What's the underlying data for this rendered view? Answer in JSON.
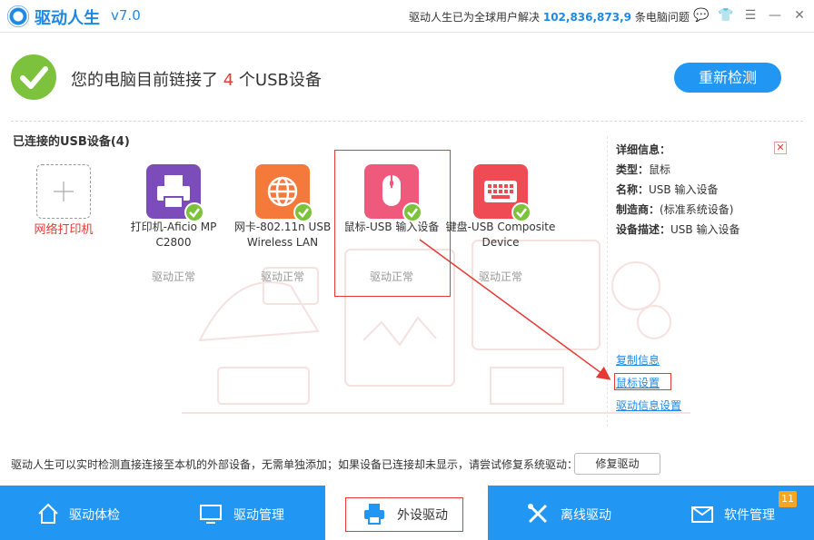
{
  "app": {
    "name": "驱动人生",
    "version": "v7.0",
    "stats_prefix": "驱动人生已为全球用户解决",
    "stats_number": "102,836,873,9",
    "stats_suffix": "条电脑问题"
  },
  "window_controls": {
    "feedback": "💬",
    "skin": "👕",
    "menu": "☰",
    "minimize": "—",
    "close": "✕"
  },
  "header": {
    "text_prefix": "您的电脑目前链接了",
    "count": "4",
    "text_suffix": "个USB设备",
    "recheck_label": "重新检测"
  },
  "section_title": "已连接的USB设备(4)",
  "add_printer_label": "网络打印机",
  "devices": [
    {
      "name": "打印机-Aficio MP C2800",
      "status": "驱动正常",
      "color": "#7c4dba"
    },
    {
      "name": "网卡-802.11n USB Wireless LAN",
      "status": "驱动正常",
      "color": "#f5793a"
    },
    {
      "name": "鼠标-USB 输入设备",
      "status": "驱动正常",
      "color": "#ef5a7c"
    },
    {
      "name": "键盘-USB Composite Device",
      "status": "驱动正常",
      "color": "#ef4b55"
    }
  ],
  "detail": {
    "title": "详细信息：",
    "rows": [
      {
        "key": "类型：",
        "value": "鼠标"
      },
      {
        "key": "名称：",
        "value": "USB 输入设备"
      },
      {
        "key": "制造商：",
        "value": "(标准系统设备)"
      },
      {
        "key": "设备描述：",
        "value": "USB 输入设备"
      }
    ],
    "links": [
      "复制信息",
      "鼠标设置",
      "驱动信息设置"
    ]
  },
  "footer_note": "驱动人生可以实时检测直接连接至本机的外部设备，无需单独添加；如果设备已连接却未显示，请尝试修复系统驱动：",
  "repair_label": "修复驱动",
  "nav": [
    {
      "label": "驱动体检",
      "icon": "home-icon"
    },
    {
      "label": "驱动管理",
      "icon": "monitor-icon"
    },
    {
      "label": "外设驱动",
      "icon": "printer-icon"
    },
    {
      "label": "离线驱动",
      "icon": "tools-icon"
    },
    {
      "label": "软件管理",
      "icon": "box-icon"
    }
  ],
  "nav_active": 2,
  "software_badge": "11",
  "colors": {
    "accent": "#2196f3",
    "success": "#7cc23c",
    "highlight": "#e53935"
  }
}
